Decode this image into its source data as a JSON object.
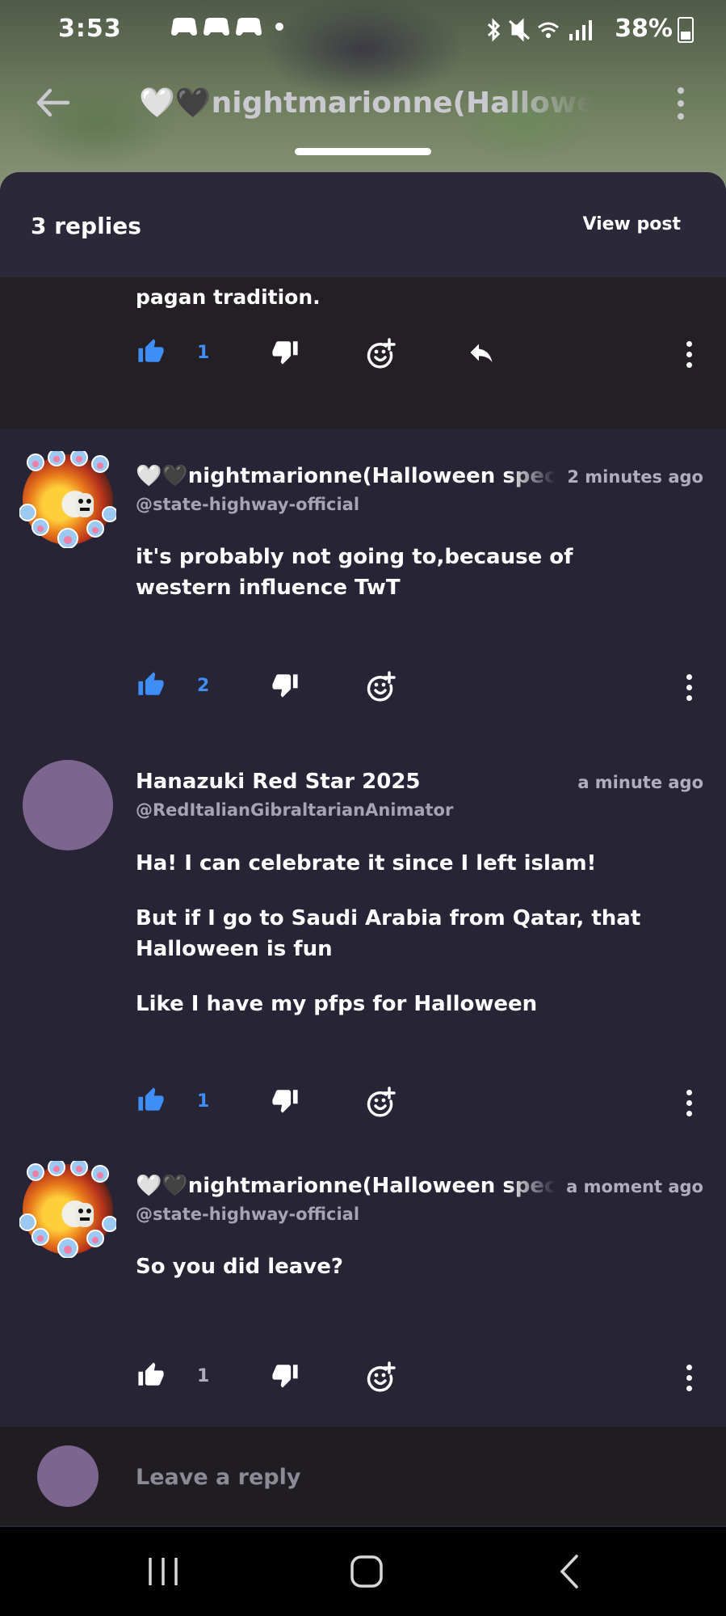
{
  "status_bar": {
    "time": "3:53",
    "battery": "38%",
    "notification_icons": [
      "gamepad-icon",
      "gamepad-icon",
      "gamepad-icon",
      "dot-icon"
    ],
    "system_icons": [
      "bluetooth-icon",
      "mute-icon",
      "wifi-icon",
      "signal-icon",
      "battery-icon"
    ]
  },
  "app_bar": {
    "title": "🤍🖤nightmarionne(Halloween s"
  },
  "sheet": {
    "replies_count": "3 replies",
    "view_post": "View post"
  },
  "previous_comment": {
    "text_tail": "pagan tradition.",
    "likes": "1"
  },
  "comments": [
    {
      "name": "🤍🖤nightmarionne(Halloween special",
      "handle": "@state-highway-official",
      "time": "2 minutes ago",
      "paragraphs": [
        "it's probably not going to,because of western influence TwT"
      ],
      "likes": "2",
      "liked": true
    },
    {
      "name": "Hanazuki Red Star 2025",
      "handle": "@RedItalianGibraltarianAnimator",
      "time": "a minute ago",
      "paragraphs": [
        "Ha! I can celebrate it since I left islam!",
        "But if I go to Saudi Arabia from Qatar, that Halloween is fun",
        "Like I have my pfps for Halloween"
      ],
      "likes": "1",
      "liked": true
    },
    {
      "name": "🤍🖤nightmarionne(Halloween special",
      "handle": "@state-highway-official",
      "time": "a moment ago",
      "paragraphs": [
        "So you did leave?"
      ],
      "likes": "1",
      "liked": false
    }
  ],
  "reply_bar": {
    "placeholder": "Leave a reply"
  },
  "colors": {
    "accent_blue": "#3f8ef5",
    "sheet_bg": "#272436",
    "avatar_purple": "#7c6690"
  }
}
